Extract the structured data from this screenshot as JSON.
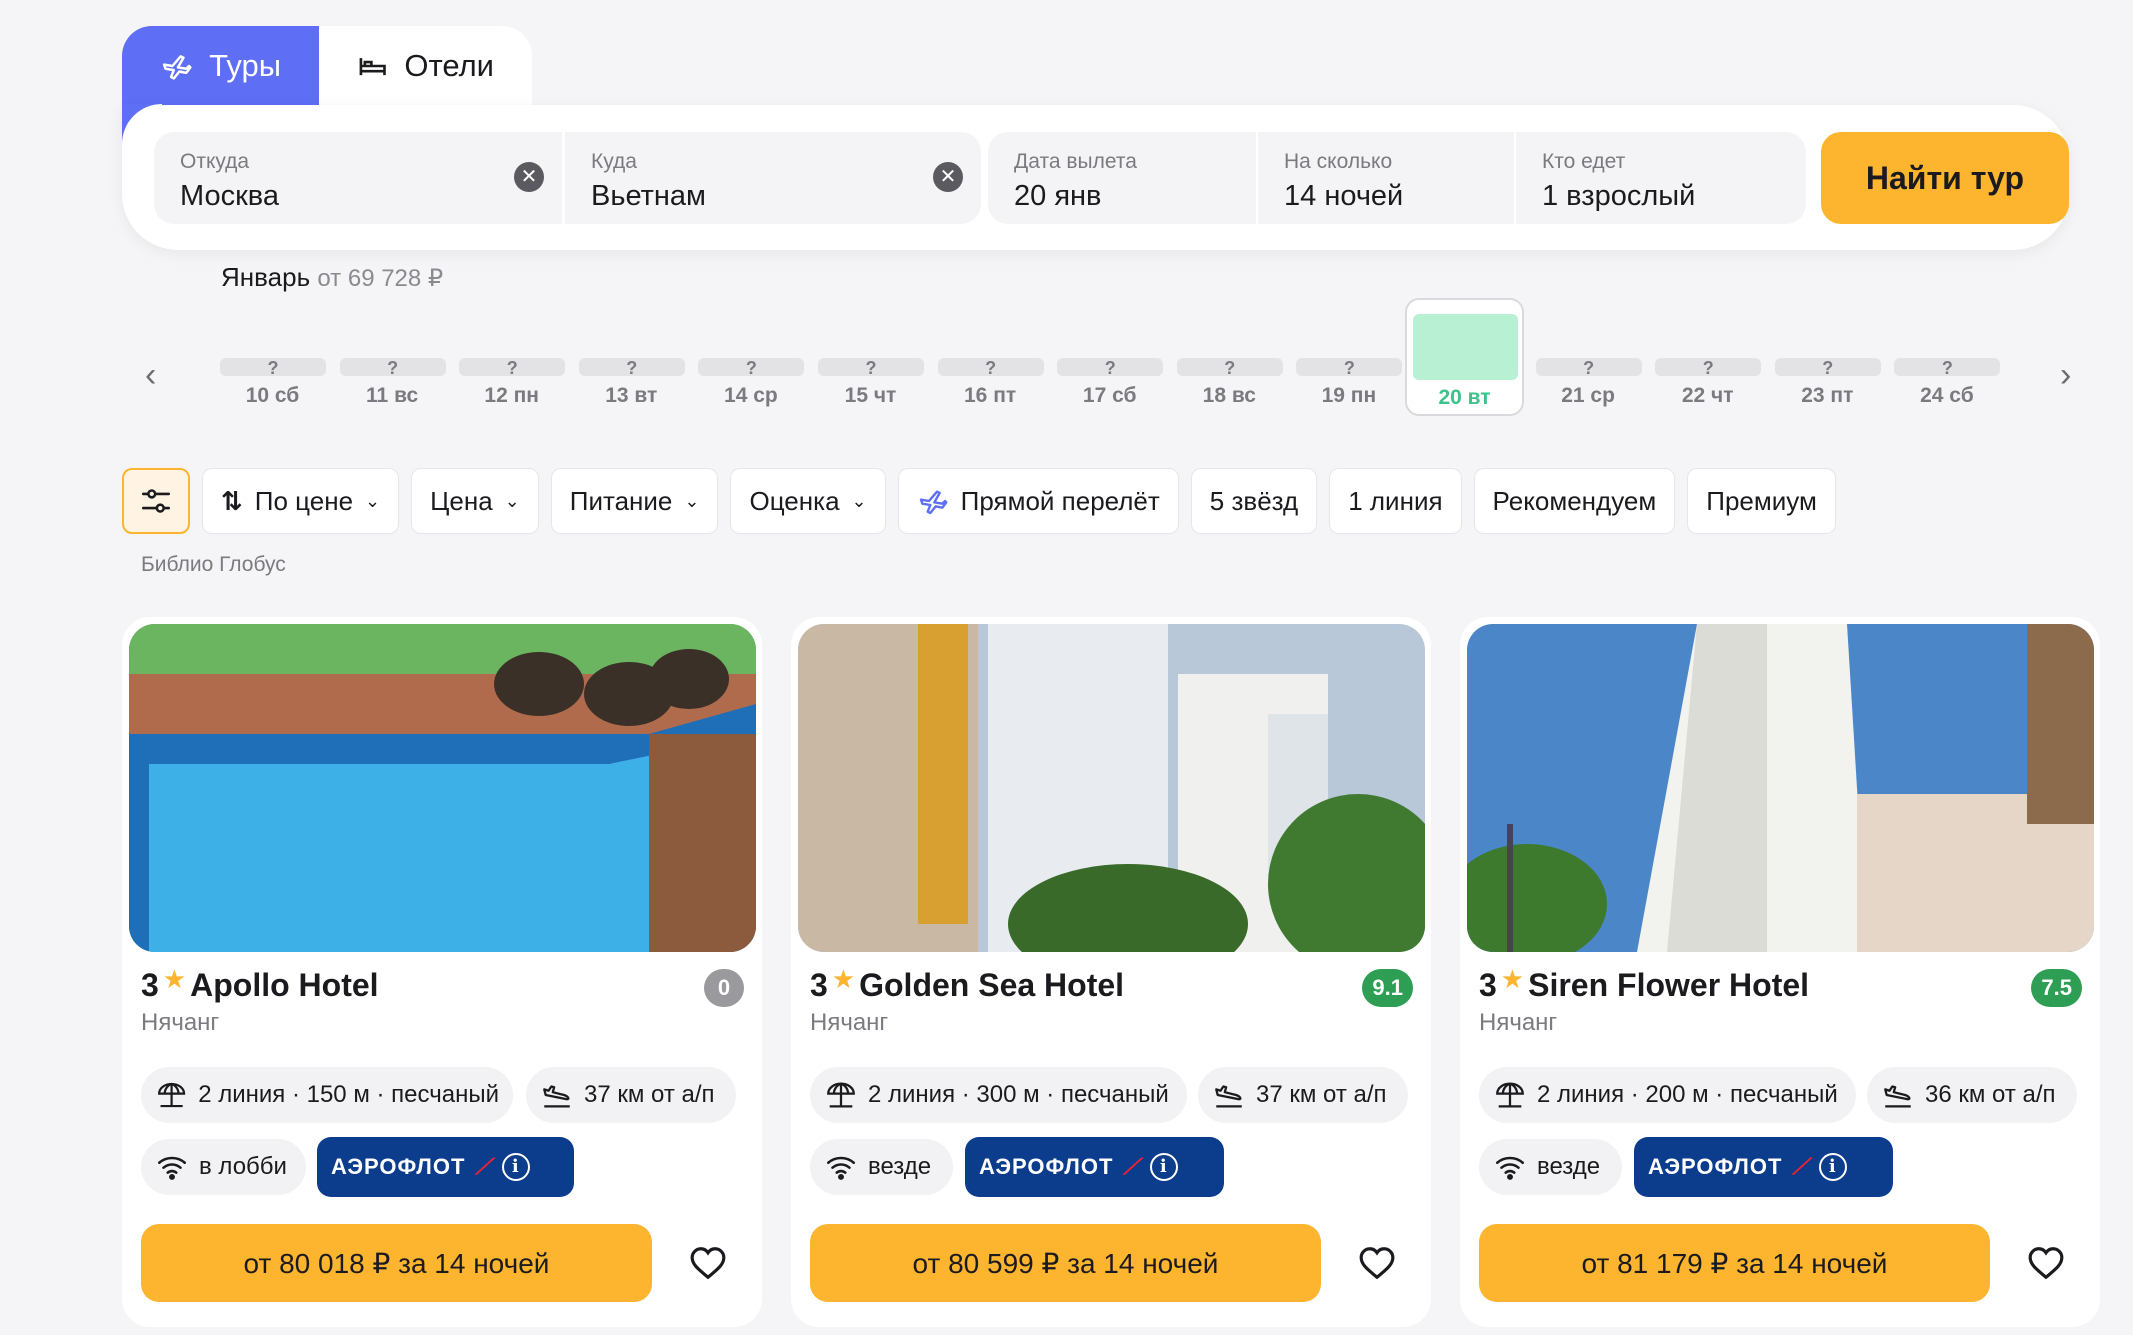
{
  "tabs": {
    "tours": "Туры",
    "hotels": "Отели"
  },
  "search": {
    "from_label": "Откуда",
    "from_value": "Москва",
    "to_label": "Куда",
    "to_value": "Вьетнам",
    "date_label": "Дата вылета",
    "date_value": "20 янв",
    "nights_label": "На сколько",
    "nights_value": "14 ночей",
    "who_label": "Кто едет",
    "who_value": "1 взрослый",
    "find_button": "Найти тур"
  },
  "calendar": {
    "month": "Январь",
    "month_price": "от 69 728 ₽",
    "unknown_price": "?",
    "days": [
      {
        "num": "10",
        "wd": "сб"
      },
      {
        "num": "11",
        "wd": "вс"
      },
      {
        "num": "12",
        "wd": "пн"
      },
      {
        "num": "13",
        "wd": "вт"
      },
      {
        "num": "14",
        "wd": "ср"
      },
      {
        "num": "15",
        "wd": "чт"
      },
      {
        "num": "16",
        "wd": "пт"
      },
      {
        "num": "17",
        "wd": "сб"
      },
      {
        "num": "18",
        "wd": "вс"
      },
      {
        "num": "19",
        "wd": "пн"
      },
      {
        "num": "20",
        "wd": "вт"
      },
      {
        "num": "21",
        "wd": "ср"
      },
      {
        "num": "22",
        "wd": "чт"
      },
      {
        "num": "23",
        "wd": "пт"
      },
      {
        "num": "24",
        "wd": "сб"
      }
    ],
    "selected_day": "20"
  },
  "filters": {
    "sort": "По цене",
    "price": "Цена",
    "food": "Питание",
    "rating": "Оценка",
    "direct": "Прямой перелёт",
    "five_stars": "5 звёзд",
    "first_line": "1 линия",
    "recommend": "Рекомендуем",
    "premium": "Премиум"
  },
  "operator": "Библио Глобус",
  "hotels": [
    {
      "stars": "3",
      "name": "Apollo Hotel",
      "city": "Нячанг",
      "rating": "0",
      "beach": "2 линия · 150 м · песчаный",
      "airport": "37 км от а/п",
      "wifi": "в лобби",
      "airline": "АЭРОФЛОТ",
      "price": "от 80 018 ₽ за 14 ночей"
    },
    {
      "stars": "3",
      "name": "Golden Sea Hotel",
      "city": "Нячанг",
      "rating": "9.1",
      "beach": "2 линия · 300 м · песчаный",
      "airport": "37 км от а/п",
      "wifi": "везде",
      "airline": "АЭРОФЛОТ",
      "price": "от 80 599 ₽ за 14 ночей"
    },
    {
      "stars": "3",
      "name": "Siren Flower Hotel",
      "city": "Нячанг",
      "rating": "7.5",
      "beach": "2 линия · 200 м · песчаный",
      "airport": "36 км от а/п",
      "wifi": "везде",
      "airline": "АЭРОФЛОТ",
      "price": "от 81 179 ₽ за 14 ночей"
    }
  ],
  "colors": {
    "accent": "#5e6ef5",
    "cta": "#fdb42f",
    "rating_green": "#2e9e55",
    "aeroflot": "#0c3c8c"
  }
}
